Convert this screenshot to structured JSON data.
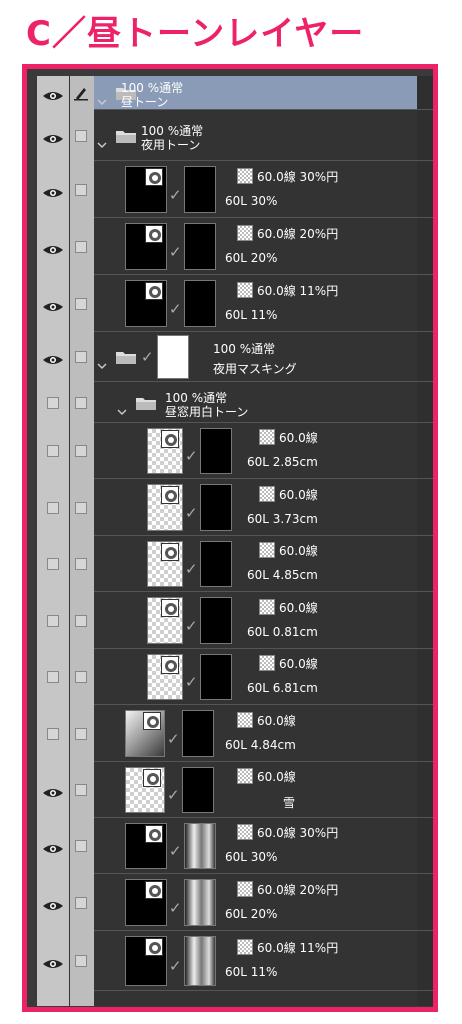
{
  "heading": "C／昼トーンレイヤー",
  "layers": [
    {
      "l1": "100 %通常",
      "l2": "昼トーン",
      "vis": true,
      "kind": "folder",
      "selected": true
    },
    {
      "l1": "100 %通常",
      "l2": "夜用トーン",
      "vis": true,
      "kind": "folder"
    },
    {
      "l1": "60.0線 30%円",
      "l2": "60L 30%",
      "vis": true,
      "kind": "tone"
    },
    {
      "l1": "60.0線 20%円",
      "l2": "60L 20%",
      "vis": true,
      "kind": "tone"
    },
    {
      "l1": "60.0線 11%円",
      "l2": "60L 11%",
      "vis": true,
      "kind": "tone"
    },
    {
      "l1": "100 %通常",
      "l2": "夜用マスキング",
      "vis": true,
      "kind": "maskfolder"
    },
    {
      "l1": "100 %通常",
      "l2": "昼窓用白トーン",
      "vis": false,
      "kind": "folder"
    },
    {
      "l1": "60.0線",
      "l2": "60L 2.85cm",
      "vis": false,
      "kind": "white"
    },
    {
      "l1": "60.0線",
      "l2": "60L 3.73cm",
      "vis": false,
      "kind": "white"
    },
    {
      "l1": "60.0線",
      "l2": "60L 4.85cm",
      "vis": false,
      "kind": "white"
    },
    {
      "l1": "60.0線",
      "l2": "60L 0.81cm",
      "vis": false,
      "kind": "white"
    },
    {
      "l1": "60.0線",
      "l2": "60L 6.81cm",
      "vis": false,
      "kind": "white"
    },
    {
      "l1": "60.0線",
      "l2": "60L 4.84cm",
      "vis": false,
      "kind": "grad"
    },
    {
      "l1": "60.0線",
      "l2": "雪",
      "vis": true,
      "kind": "white2"
    },
    {
      "l1": "60.0線 30%円",
      "l2": "60L 30%",
      "vis": true,
      "kind": "building"
    },
    {
      "l1": "60.0線 20%円",
      "l2": "60L 20%",
      "vis": true,
      "kind": "building"
    },
    {
      "l1": "60.0線 11%円",
      "l2": "60L 11%",
      "vis": true,
      "kind": "building"
    }
  ],
  "colors": {
    "accent": "#ee2268",
    "panel": "#333333",
    "selected": "#8a9bb8"
  },
  "icons": {
    "visibility": "eye-icon",
    "hidden": "checkbox-icon",
    "edit": "pen-icon",
    "folder": "folder-icon",
    "expand": "chevron-down-icon",
    "tone": "tone-badge-icon"
  }
}
